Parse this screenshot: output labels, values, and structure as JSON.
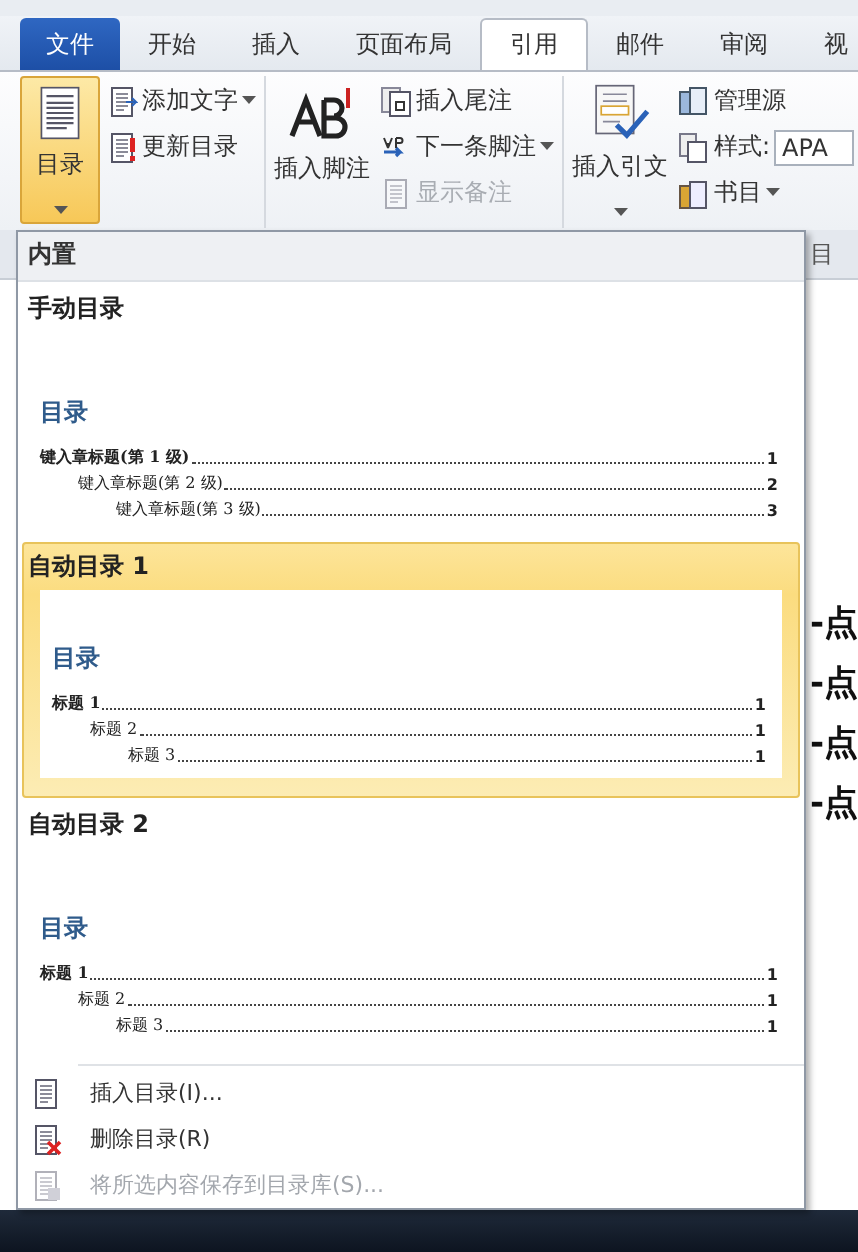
{
  "tabs": [
    {
      "label": "文件",
      "kind": "file",
      "selected": false
    },
    {
      "label": "开始",
      "kind": "tab",
      "selected": false
    },
    {
      "label": "插入",
      "kind": "tab",
      "selected": false
    },
    {
      "label": "页面布局",
      "kind": "tab",
      "selected": false
    },
    {
      "label": "引用",
      "kind": "tab",
      "selected": true
    },
    {
      "label": "邮件",
      "kind": "tab",
      "selected": false
    },
    {
      "label": "审阅",
      "kind": "tab",
      "selected": false
    },
    {
      "label": "视",
      "kind": "tab",
      "selected": false
    }
  ],
  "ribbon": {
    "groups": [
      {
        "big": {
          "label": "目录",
          "dropdown": true,
          "pressed": true
        },
        "small": [
          {
            "label": "添加文字",
            "kind": "button",
            "dropdown": true,
            "disabled": false
          },
          {
            "label": "更新目录",
            "kind": "button",
            "dropdown": false,
            "disabled": false
          }
        ]
      },
      {
        "big": {
          "label": "插入脚注",
          "dropdown": false,
          "pressed": false
        },
        "small": [
          {
            "label": "插入尾注",
            "kind": "button",
            "dropdown": false,
            "disabled": false
          },
          {
            "label": "下一条脚注",
            "kind": "button",
            "dropdown": true,
            "disabled": false
          },
          {
            "label": "显示备注",
            "kind": "button",
            "dropdown": false,
            "disabled": true
          }
        ]
      },
      {
        "big": {
          "label": "插入引文",
          "dropdown": true,
          "pressed": false
        },
        "small": [
          {
            "label": "管理源",
            "kind": "button",
            "dropdown": false,
            "disabled": false
          },
          {
            "label": "样式:",
            "kind": "field",
            "value": "APA"
          },
          {
            "label": "书目",
            "kind": "button",
            "dropdown": true,
            "disabled": false
          }
        ]
      }
    ],
    "group_label_fragment": "目"
  },
  "toc_menu": {
    "header": "内置",
    "items": [
      {
        "title": "手动目录",
        "selected": false,
        "preview": {
          "heading": "目录",
          "entries": [
            {
              "text": "键入章标题(第 1 级)",
              "page": "1",
              "children": [
                {
                  "text": "键入章标题(第 2 级)",
                  "page": "2",
                  "children": [
                    {
                      "text": "键入章标题(第 3 级)",
                      "page": "3"
                    }
                  ]
                }
              ]
            }
          ]
        }
      },
      {
        "title": "自动目录 1",
        "selected": true,
        "preview": {
          "heading": "目录",
          "entries": [
            {
              "text": "标题 1",
              "page": "1",
              "children": [
                {
                  "text": "标题 2",
                  "page": "1",
                  "children": [
                    {
                      "text": "标题 3",
                      "page": "1"
                    }
                  ]
                }
              ]
            }
          ]
        }
      },
      {
        "title": "自动目录 2",
        "selected": false,
        "preview": {
          "heading": "目录",
          "entries": [
            {
              "text": "标题 1",
              "page": "1",
              "children": [
                {
                  "text": "标题 2",
                  "page": "1",
                  "children": [
                    {
                      "text": "标题 3",
                      "page": "1"
                    }
                  ]
                }
              ]
            }
          ]
        }
      }
    ],
    "commands": [
      {
        "label": "插入目录(I)...",
        "disabled": false
      },
      {
        "label": "删除目录(R)",
        "disabled": false
      },
      {
        "label": "将所选内容保存到目录库(S)...",
        "disabled": true
      }
    ]
  },
  "document": {
    "lines": [
      "-点",
      "-点",
      "-点",
      "-点"
    ]
  }
}
